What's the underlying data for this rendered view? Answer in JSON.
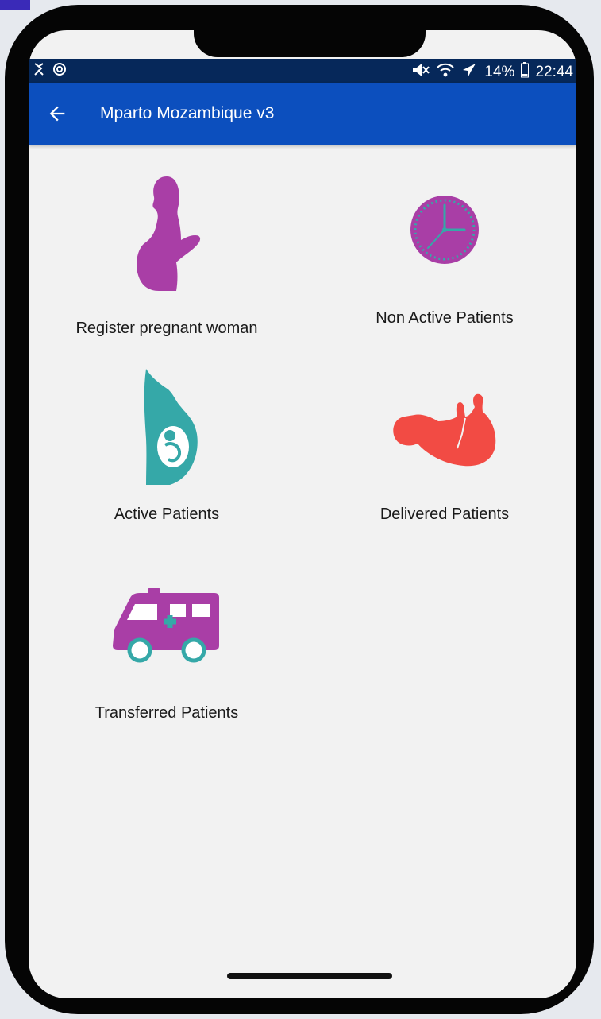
{
  "status_bar": {
    "battery": "14%",
    "time": "22:44"
  },
  "app_bar": {
    "title": "Mparto Mozambique v3"
  },
  "menu": {
    "register": {
      "label": "Register pregnant woman"
    },
    "non_active": {
      "label": "Non Active Patients"
    },
    "active": {
      "label": "Active Patients"
    },
    "delivered": {
      "label": "Delivered Patients"
    },
    "transferred": {
      "label": "Transferred Patients"
    }
  },
  "icons": {
    "register": "pregnant-woman-icon",
    "non_active": "clock-icon",
    "active": "fetus-womb-icon",
    "delivered": "baby-icon",
    "transferred": "ambulance-icon"
  },
  "colors": {
    "app_bar": "#0c4fbe",
    "status_bar": "#06285a",
    "purple": "#a93ea6",
    "teal": "#35a8a8",
    "coral": "#f24b44"
  }
}
